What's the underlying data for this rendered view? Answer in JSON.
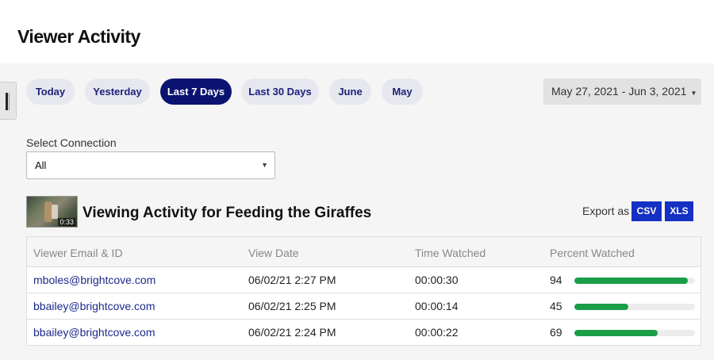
{
  "header": {
    "title": "Viewer Activity"
  },
  "filters": {
    "pills": [
      {
        "label": "Today",
        "active": false
      },
      {
        "label": "Yesterday",
        "active": false
      },
      {
        "label": "Last 7 Days",
        "active": true
      },
      {
        "label": "Last 30 Days",
        "active": false
      },
      {
        "label": "June",
        "active": false
      },
      {
        "label": "May",
        "active": false
      }
    ],
    "date_range": "May 27, 2021 - Jun 3, 2021",
    "date_range_caret": "▼"
  },
  "connection": {
    "label": "Select Connection",
    "value": "All",
    "arrow": "▼"
  },
  "video": {
    "duration": "0:33",
    "title": "Viewing Activity for Feeding the Giraffes"
  },
  "export": {
    "label": "Export as",
    "csv": "CSV",
    "xls": "XLS"
  },
  "table": {
    "columns": [
      "Viewer Email & ID",
      "View Date",
      "Time Watched",
      "Percent Watched"
    ],
    "rows": [
      {
        "email": "mboles@brightcove.com",
        "date": "06/02/21 2:27 PM",
        "time": "00:00:30",
        "percent": 94
      },
      {
        "email": "bbailey@brightcove.com",
        "date": "06/02/21 2:25 PM",
        "time": "00:00:14",
        "percent": 45
      },
      {
        "email": "bbailey@brightcove.com",
        "date": "06/02/21 2:24 PM",
        "time": "00:00:22",
        "percent": 69
      }
    ]
  },
  "colors": {
    "accent": "#0b1371",
    "progress": "#1a9e48",
    "export": "#1530c4"
  }
}
